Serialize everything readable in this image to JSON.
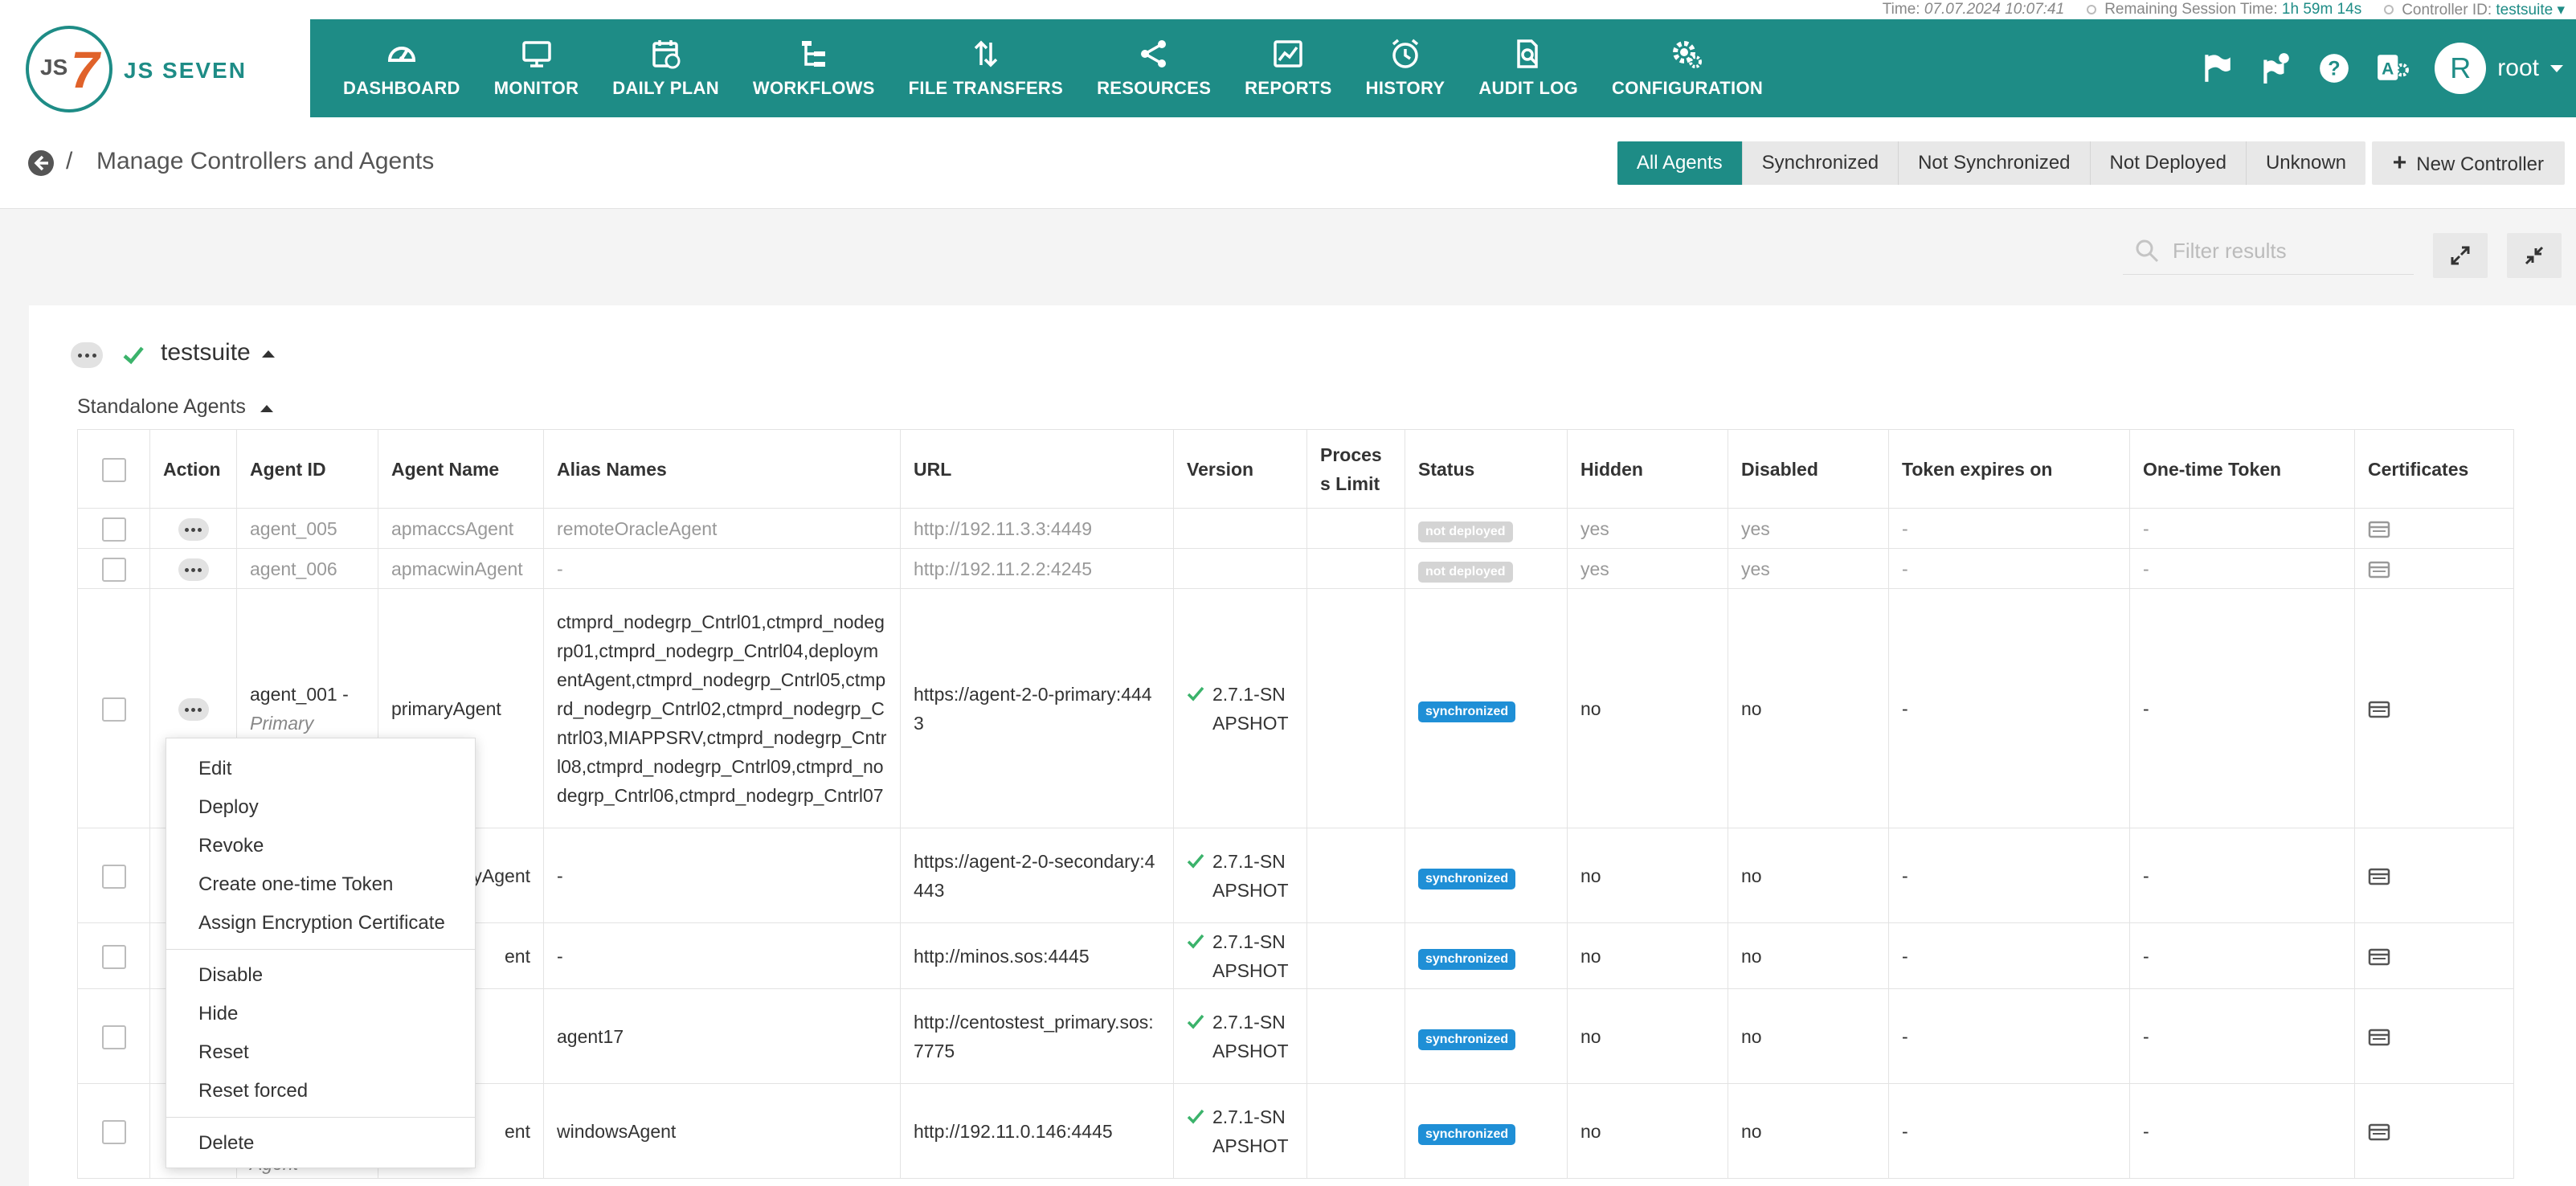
{
  "status_bar": {
    "time_label": "Time:",
    "time_value": "07.07.2024 10:07:41",
    "session_label": "Remaining Session Time:",
    "session_value": "1h 59m 14s",
    "controller_label": "Controller ID:",
    "controller_value": "testsuite"
  },
  "logo": {
    "text": "JS SEVEN",
    "badge_js": "JS",
    "badge_seven": "7"
  },
  "nav": [
    {
      "label": "DASHBOARD",
      "icon": "dashboard-icon"
    },
    {
      "label": "MONITOR",
      "icon": "monitor-icon"
    },
    {
      "label": "DAILY PLAN",
      "icon": "daily-plan-icon"
    },
    {
      "label": "WORKFLOWS",
      "icon": "workflows-icon"
    },
    {
      "label": "FILE TRANSFERS",
      "icon": "file-transfers-icon"
    },
    {
      "label": "RESOURCES",
      "icon": "resources-icon"
    },
    {
      "label": "REPORTS",
      "icon": "reports-icon"
    },
    {
      "label": "HISTORY",
      "icon": "history-icon"
    },
    {
      "label": "AUDIT LOG",
      "icon": "audit-log-icon"
    },
    {
      "label": "CONFIGURATION",
      "icon": "configuration-icon"
    }
  ],
  "user": {
    "initial": "R",
    "name": "root"
  },
  "page": {
    "title": "Manage Controllers and Agents",
    "breadcrumb_sep": "/"
  },
  "filters": [
    "All Agents",
    "Synchronized",
    "Not Synchronized",
    "Not Deployed",
    "Unknown"
  ],
  "new_controller_label": "New Controller",
  "search": {
    "placeholder": "Filter results"
  },
  "controller": {
    "name": "testsuite",
    "section": "Standalone Agents"
  },
  "table": {
    "headers": [
      "Action",
      "Agent ID",
      "Agent Name",
      "Alias Names",
      "URL",
      "Version",
      "Proces s Limit",
      "Status",
      "Hidden",
      "Disabled",
      "Token expires on",
      "One-time Token",
      "Certificates"
    ],
    "rows": [
      {
        "agent_id": "agent_005",
        "agent_id_sub": "",
        "name": "apmaccsAgent",
        "alias": "remoteOracleAgent",
        "url": "http://192.11.3.3:4449",
        "version": "",
        "limit": "",
        "status": "not deployed",
        "hidden": "yes",
        "disabled": "yes",
        "token": "-",
        "onetime": "-"
      },
      {
        "agent_id": "agent_006",
        "agent_id_sub": "",
        "name": "apmacwinAgent",
        "alias": "-",
        "url": "http://192.11.2.2:4245",
        "version": "",
        "limit": "",
        "status": "not deployed",
        "hidden": "yes",
        "disabled": "yes",
        "token": "-",
        "onetime": "-"
      },
      {
        "agent_id": "agent_001 -",
        "agent_id_sub": "Primary",
        "name": "primaryAgent",
        "alias": "ctmprd_nodegrp_Cntrl01,ctmprd_nodegrp01,ctmprd_nodegrp_Cntrl04,deploymentAgent,ctmprd_nodegrp_Cntrl05,ctmprd_nodegrp_Cntrl02,ctmprd_nodegrp_Cntrl03,MIAPPSRV,ctmprd_nodegrp_Cntrl08,ctmprd_nodegrp_Cntrl09,ctmprd_nodegrp_Cntrl06,ctmprd_nodegrp_Cntrl07",
        "url": "https://agent-2-0-primary:4443",
        "version": "2.7.1-SNAPSHOT",
        "limit": "",
        "status": "synchronized",
        "hidden": "no",
        "disabled": "no",
        "token": "-",
        "onetime": "-"
      },
      {
        "agent_id": "",
        "agent_id_sub": "",
        "name": "ryAgent",
        "alias": "-",
        "url": "https://agent-2-0-secondary:4443",
        "version": "2.7.1-SNAPSHOT",
        "limit": "",
        "status": "synchronized",
        "hidden": "no",
        "disabled": "no",
        "token": "-",
        "onetime": "-"
      },
      {
        "agent_id": "",
        "agent_id_sub": "",
        "name": "ent",
        "alias": "-",
        "url": "http://minos.sos:4445",
        "version": "2.7.1-SNAPSHOT",
        "limit": "",
        "status": "synchronized",
        "hidden": "no",
        "disabled": "no",
        "token": "-",
        "onetime": "-"
      },
      {
        "agent_id": "",
        "agent_id_sub": "",
        "name": "",
        "alias": "agent17",
        "url": "http://centostest_primary.sos:7775",
        "version": "2.7.1-SNAPSHOT",
        "limit": "",
        "status": "synchronized",
        "hidden": "no",
        "disabled": "no",
        "token": "-",
        "onetime": "-"
      },
      {
        "agent_id": "",
        "agent_id_sub": "Agent",
        "name": "ent",
        "alias": "windowsAgent",
        "url": "http://192.11.0.146:4445",
        "version": "2.7.1-SNAPSHOT",
        "limit": "",
        "status": "synchronized",
        "hidden": "no",
        "disabled": "no",
        "token": "-",
        "onetime": "-"
      }
    ]
  },
  "context_menu": {
    "group1": [
      "Edit",
      "Deploy",
      "Revoke",
      "Create one-time Token",
      "Assign Encryption Certificate"
    ],
    "group2": [
      "Disable",
      "Hide",
      "Reset",
      "Reset forced"
    ],
    "group3": [
      "Delete"
    ]
  },
  "colors": {
    "brand": "#1e8c86",
    "accent_orange": "#e0622a",
    "sync_badge": "#1f8fd6",
    "check_green": "#3bb36b"
  }
}
